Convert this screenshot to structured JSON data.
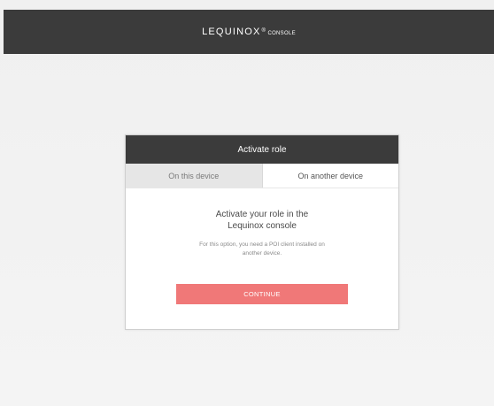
{
  "header": {
    "brand_name": "LEQUINOX",
    "brand_mark": "®",
    "brand_sub": "CONSOLE"
  },
  "dialog": {
    "title": "Activate role",
    "tabs": [
      {
        "label": "On this device",
        "active": false
      },
      {
        "label": "On another device",
        "active": true
      }
    ],
    "heading_line1": "Activate your role in the",
    "heading_line2": "Lequinox console",
    "description_line1": "For this option, you need a POI client installed on",
    "description_line2": "another device.",
    "continue_label": "CONTINUE"
  },
  "colors": {
    "header_bg": "#3b3b3b",
    "accent": "#f07878",
    "page_bg": "#f2f2f2"
  }
}
